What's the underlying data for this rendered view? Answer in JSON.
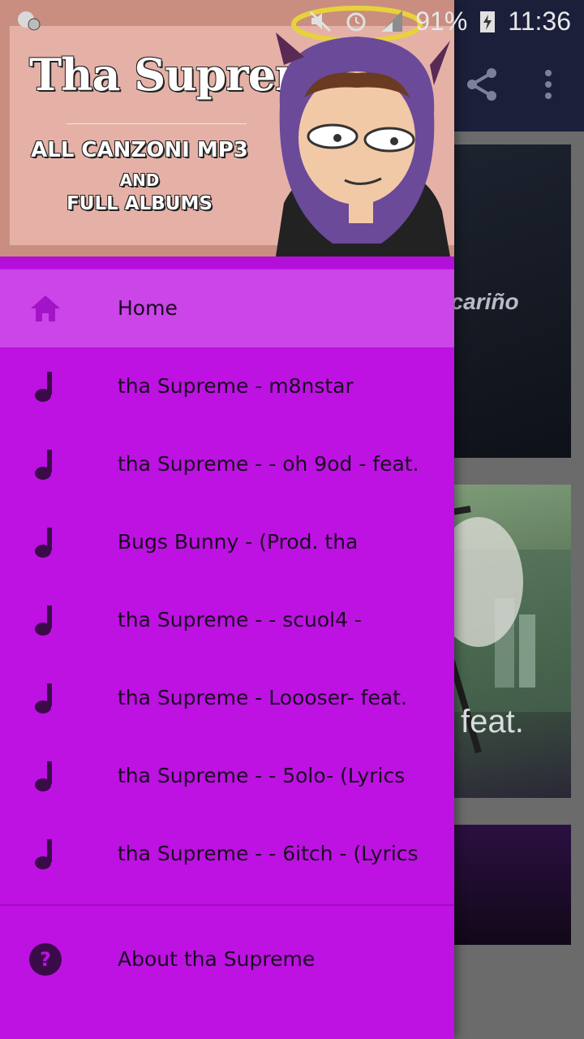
{
  "status_bar": {
    "battery": "91%",
    "time": "11:36"
  },
  "header": {
    "title": "Tha Supreme",
    "line1": "ALL CANZONI MP3",
    "line2": "AND",
    "line3": "FULL ALBUMS"
  },
  "menu": {
    "items": [
      {
        "label": "Home",
        "icon": "home-icon"
      },
      {
        "label": "tha Supreme - m8nstar",
        "icon": "music-note-icon"
      },
      {
        "label": "tha Supreme - - oh 9od - feat.",
        "icon": "music-note-icon"
      },
      {
        "label": "Bugs Bunny - (Prod. tha",
        "icon": "music-note-icon"
      },
      {
        "label": "tha Supreme - - scuol4 -",
        "icon": "music-note-icon"
      },
      {
        "label": "tha Supreme - Loooser- feat.",
        "icon": "music-note-icon"
      },
      {
        "label": "tha Supreme - - 5olo- (Lyrics",
        "icon": "music-note-icon"
      },
      {
        "label": "tha Supreme - - 6itch - (Lyrics",
        "icon": "music-note-icon"
      }
    ],
    "about": {
      "label": "About tha Supreme",
      "icon": "help-icon"
    }
  },
  "background": {
    "card1_text": ", cariño",
    "card2_text": "feat."
  },
  "colors": {
    "drawer": "#bd12e2",
    "active_item": "#cb45e8",
    "app_bar": "#1b1f3a"
  }
}
